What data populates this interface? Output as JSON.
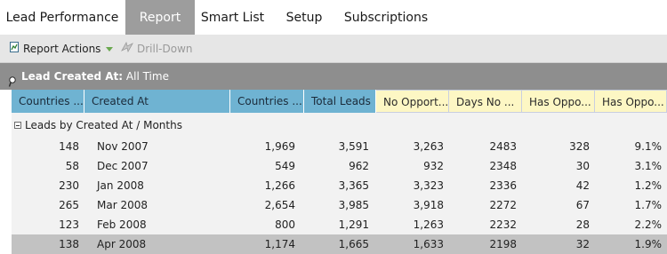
{
  "tabs": [
    {
      "label": "Lead Performance"
    },
    {
      "label": "Report"
    },
    {
      "label": "Smart List"
    },
    {
      "label": "Setup"
    },
    {
      "label": "Subscriptions"
    }
  ],
  "toolbar": {
    "report_actions_label": "Report Actions",
    "drill_down_label": "Drill-Down"
  },
  "filter": {
    "label": "Lead Created At:",
    "value": "All Time"
  },
  "columns": [
    "Countries ...",
    "Created At",
    "Countries ...",
    "Total Leads",
    "No Opport...",
    "Days No ...",
    "Has Oppo...",
    "Has Oppo..."
  ],
  "group_label": "Leads by Created At / Months",
  "rows": [
    [
      "148",
      "Nov 2007",
      "1,969",
      "3,591",
      "3,263",
      "2483",
      "328",
      "9.1%"
    ],
    [
      "58",
      "Dec 2007",
      "549",
      "962",
      "932",
      "2348",
      "30",
      "3.1%"
    ],
    [
      "230",
      "Jan 2008",
      "1,266",
      "3,365",
      "3,323",
      "2336",
      "42",
      "1.2%"
    ],
    [
      "265",
      "Mar 2008",
      "2,654",
      "3,985",
      "3,918",
      "2272",
      "67",
      "1.7%"
    ],
    [
      "123",
      "Feb 2008",
      "800",
      "1,291",
      "1,263",
      "2232",
      "28",
      "2.2%"
    ],
    [
      "138",
      "Apr 2008",
      "1,174",
      "1,665",
      "1,633",
      "2198",
      "32",
      "1.9%"
    ]
  ],
  "icons": {
    "report_actions": "report-actions-icon",
    "drill_down": "drill-down-icon",
    "filter": "filter-icon"
  },
  "colors": {
    "active_tab": "#9d9d9d",
    "header_blue": "#6fb3d2",
    "header_yellow": "#fdf7c4",
    "selected_row": "#c2c2c2"
  }
}
